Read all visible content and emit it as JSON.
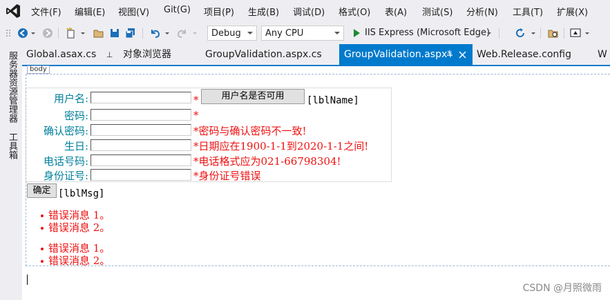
{
  "menu": [
    "文件(F)",
    "编辑(E)",
    "视图(V)",
    "Git(G)",
    "项目(P)",
    "生成(B)",
    "调试(D)",
    "格式(O)",
    "表(A)",
    "测试(S)",
    "分析(N)",
    "工具(T)",
    "扩展(X)"
  ],
  "toolbar": {
    "config": "Debug",
    "platform": "Any CPU",
    "run_target": "IIS Express (Microsoft Edge)"
  },
  "side_panels": [
    "服务器资源管理器",
    "工具箱"
  ],
  "tabs": [
    {
      "label": "Global.asax.cs",
      "pin": "⊥"
    },
    {
      "label": "对象浏览器"
    },
    {
      "label": "GroupValidation.aspx.cs"
    },
    {
      "label": "GroupValidation.aspx*",
      "active": true
    },
    {
      "label": "Web.Release.config"
    },
    {
      "label": "W"
    }
  ],
  "designer": {
    "body_tag": "body",
    "rows": [
      {
        "label": "用户名:",
        "error": "*"
      },
      {
        "label": "密码:",
        "error": "*"
      },
      {
        "label": "确认密码:",
        "error": "*密码与确认密码不一致!"
      },
      {
        "label": "生日:",
        "error": "*日期应在1900-1-1到2020-1-1之间!"
      },
      {
        "label": "电话号码:",
        "error": "*电话格式应为021-66798304!"
      },
      {
        "label": "身份证号:",
        "error": "*身份证号错误"
      }
    ],
    "check_button": "用户名是否可用",
    "lbl_name": "[lblName]",
    "submit_button": "确定",
    "lbl_msg": "[lblMsg]",
    "summary1": [
      "错误消息 1。",
      "错误消息 2。"
    ],
    "summary2": [
      "错误消息 1。",
      "错误消息 2。"
    ]
  },
  "watermark": "CSDN @月照微雨",
  "colors": {
    "accent": "#007acc",
    "label": "#00809c",
    "error": "#e11111"
  }
}
